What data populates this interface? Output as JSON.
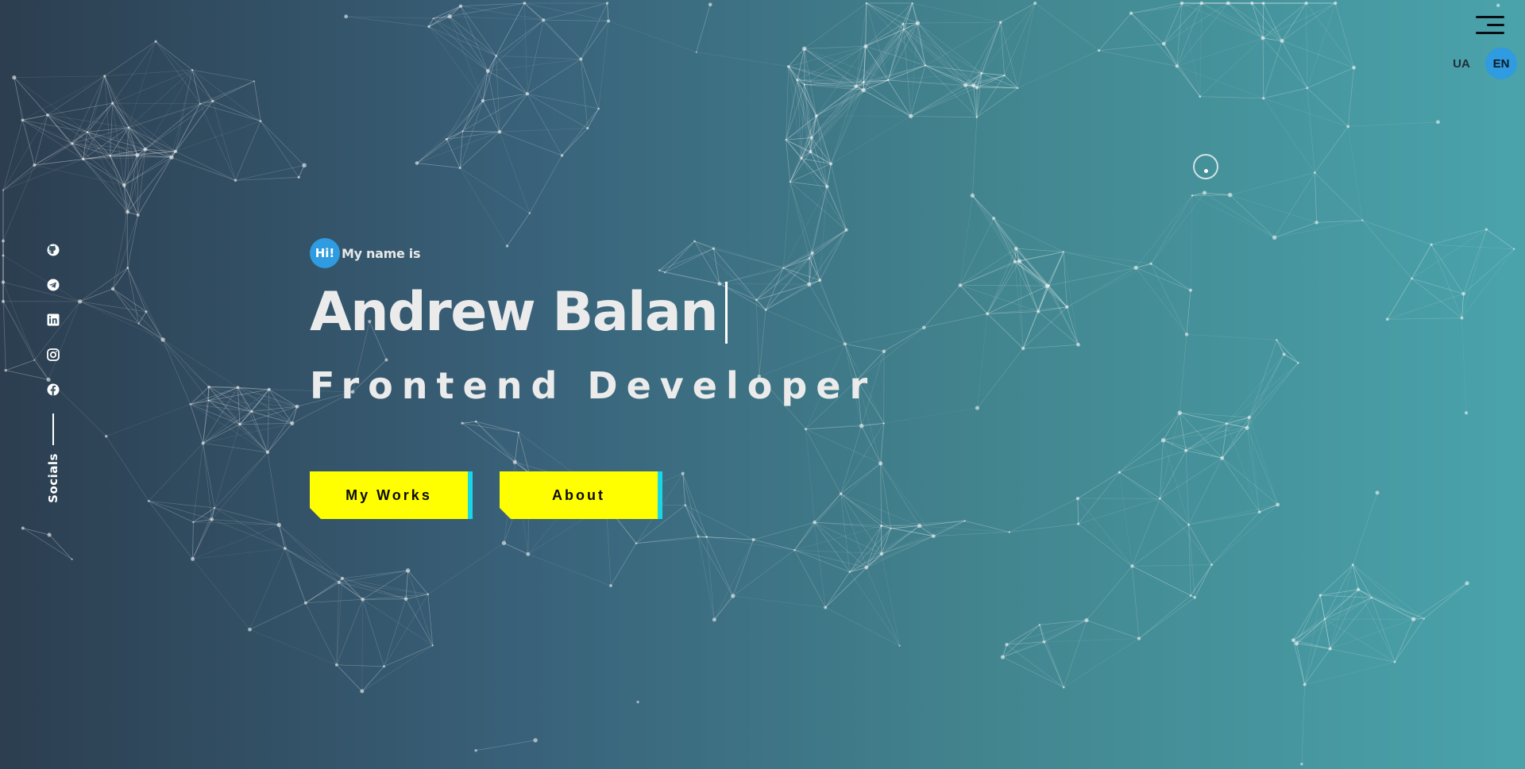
{
  "header": {
    "menu_icon": "hamburger-menu-icon",
    "languages": [
      {
        "label": "UA",
        "active": false
      },
      {
        "label": "EN",
        "active": true
      }
    ]
  },
  "socials": {
    "icons": [
      "github-icon",
      "telegram-icon",
      "linkedin-icon",
      "instagram-icon",
      "facebook-icon"
    ],
    "label": "Socials"
  },
  "hero": {
    "greeting_badge": "Hi!",
    "greeting_text": "My name is",
    "name": "Andrew Balan",
    "role": "Frontend Developer"
  },
  "actions": {
    "works_label": "My Works",
    "about_label": "About"
  },
  "colors": {
    "accent_blue": "#2f9be0",
    "button_yellow": "#ffff00",
    "button_edge_cyan": "#18d8e6",
    "gradient_start": "#2c3e50",
    "gradient_end": "#4aa3ab"
  }
}
